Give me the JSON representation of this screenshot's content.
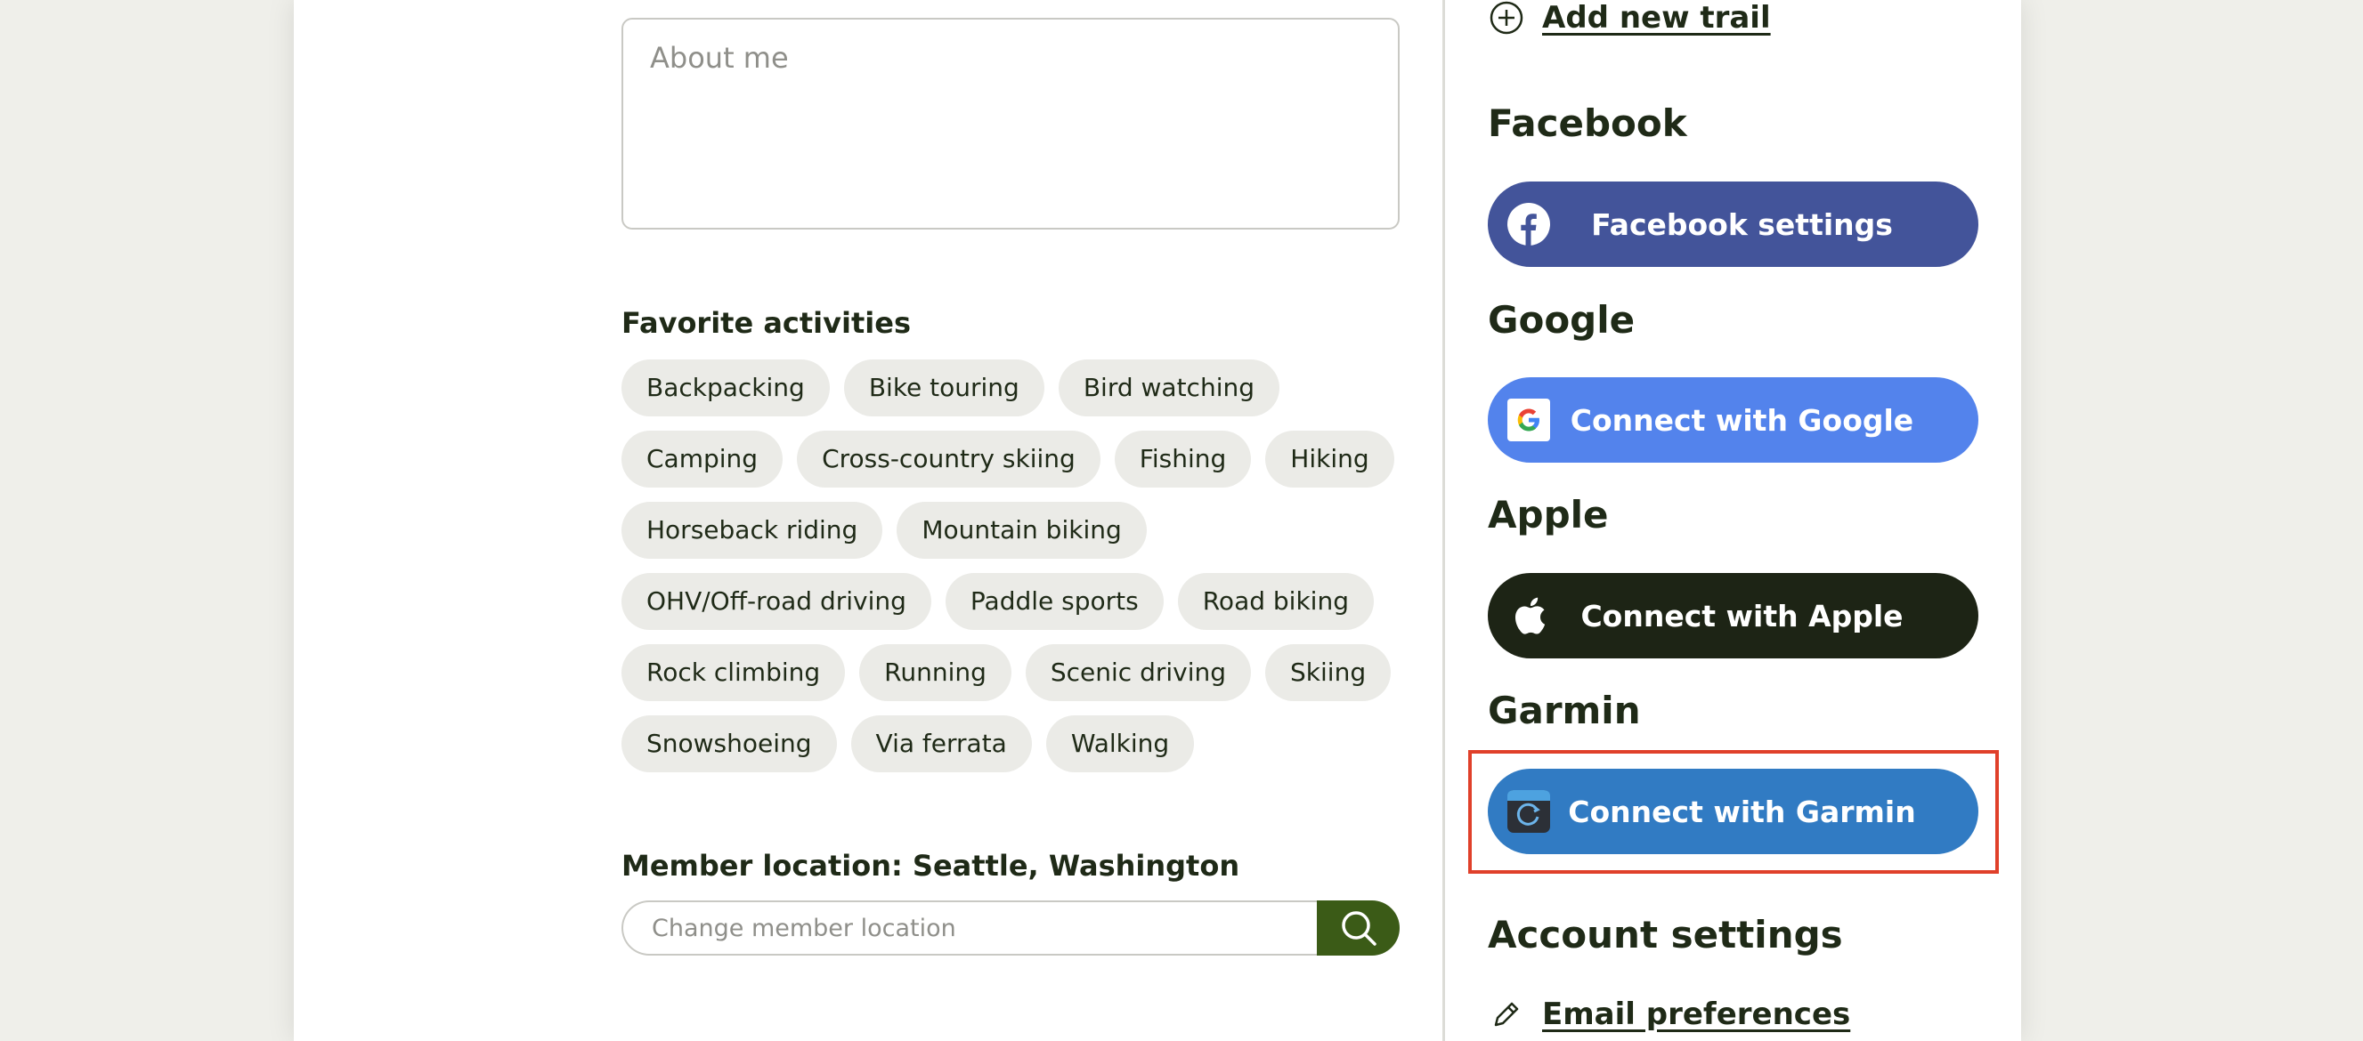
{
  "profile": {
    "about_placeholder": "About me",
    "favorite_activities_label": "Favorite activities",
    "activities": [
      "Backpacking",
      "Bike touring",
      "Bird watching",
      "Camping",
      "Cross-country skiing",
      "Fishing",
      "Hiking",
      "Horseback riding",
      "Mountain biking",
      "OHV/Off-road driving",
      "Paddle sports",
      "Road biking",
      "Rock climbing",
      "Running",
      "Scenic driving",
      "Skiing",
      "Snowshoeing",
      "Via ferrata",
      "Walking"
    ],
    "member_location_label": "Member location: Seattle, Washington",
    "location_placeholder": "Change member location"
  },
  "sidebar": {
    "add_trail_label": "Add new trail",
    "facebook": {
      "heading": "Facebook",
      "button_label": "Facebook settings",
      "color": "#43549a"
    },
    "google": {
      "heading": "Google",
      "button_label": "Connect with Google",
      "color": "#5383ec"
    },
    "apple": {
      "heading": "Apple",
      "button_label": "Connect with Apple",
      "color": "#1d2415"
    },
    "garmin": {
      "heading": "Garmin",
      "button_label": "Connect with Garmin",
      "color": "#317bc3"
    },
    "account_settings_heading": "Account settings",
    "email_preferences_label": "Email preferences"
  },
  "colors": {
    "primary_green": "#3b5b17",
    "highlight": "#e0402a",
    "chip_bg": "#ebebe7"
  }
}
